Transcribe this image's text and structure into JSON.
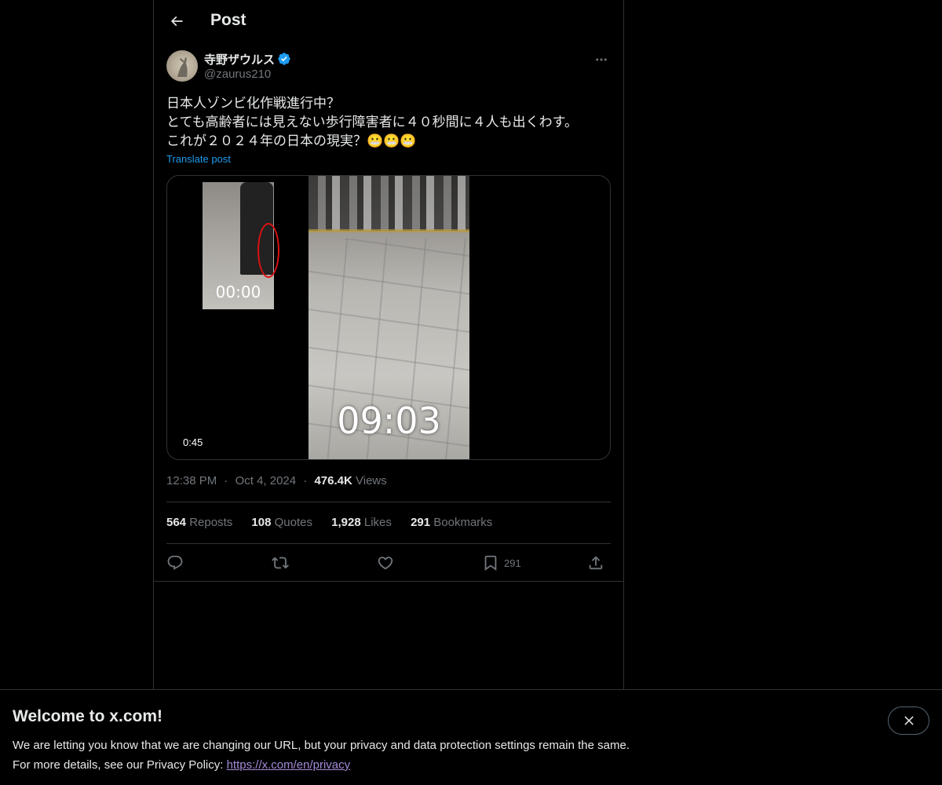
{
  "header": {
    "title": "Post",
    "back_icon": "arrow-left-icon"
  },
  "author": {
    "display_name": "寺野ザウルス",
    "handle": "@zaurus210",
    "verified": true,
    "verified_color": "#1d9bf0"
  },
  "post": {
    "text_line1": "日本人ゾンビ化作戦進行中？",
    "text_line2": "とても高齢者には見えない歩行障害者に４０秒間に４人も出くわす。",
    "text_line3": "これが２０２４年の日本の現実？😬😬😬",
    "translate_label": "Translate post"
  },
  "media": {
    "duration": "0:45",
    "overlay_time_large": "09:03",
    "overlay_time_small": "00:00"
  },
  "meta": {
    "time": "12:38 PM",
    "separator": "·",
    "date": "Oct 4, 2024",
    "views_count": "476.4K",
    "views_label": "Views"
  },
  "stats": {
    "reposts_count": "564",
    "reposts_label": "Reposts",
    "quotes_count": "108",
    "quotes_label": "Quotes",
    "likes_count": "1,928",
    "likes_label": "Likes",
    "bookmarks_count": "291",
    "bookmarks_label": "Bookmarks"
  },
  "actions": {
    "reply_icon": "reply-icon",
    "repost_icon": "repost-icon",
    "like_icon": "heart-icon",
    "bookmark_icon": "bookmark-icon",
    "bookmark_count": "291",
    "share_icon": "share-icon"
  },
  "banner": {
    "title": "Welcome to x.com!",
    "line1": "We are letting you know that we are changing our URL, but your privacy and data protection settings remain the same.",
    "line2_prefix": "For more details, see our Privacy Policy: ",
    "link_text": "https://x.com/en/privacy",
    "link_color": "#a48bd8"
  },
  "colors": {
    "background": "#000000",
    "text": "#e7e9ea",
    "muted": "#71767b",
    "accent": "#1d9bf0",
    "border": "#2f3336"
  }
}
